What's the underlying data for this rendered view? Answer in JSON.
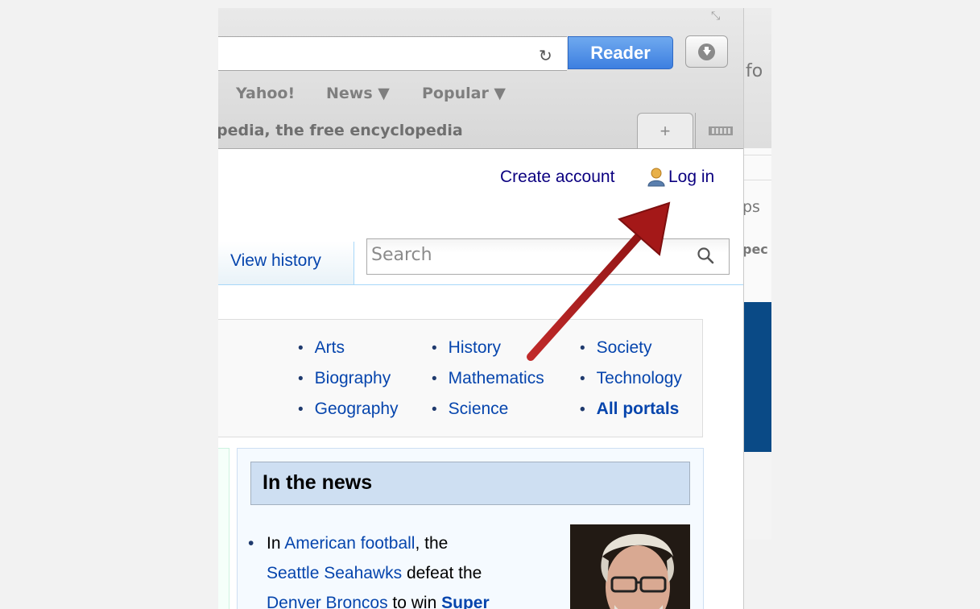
{
  "browser": {
    "reader_label": "Reader",
    "bookmarks": [
      "Yahoo!",
      "News ▼",
      "Popular ▼"
    ],
    "tab_title": "pedia, the free encyclopedia",
    "new_tab_symbol": "+",
    "reload_symbol": "↻",
    "resize_symbol": "⤡"
  },
  "wiki": {
    "create_account": "Create account",
    "login": "Log in",
    "view_history": "View history",
    "search_placeholder": "Search",
    "portals": {
      "col1": [
        "Arts",
        "Biography",
        "Geography"
      ],
      "col2": [
        "History",
        "Mathematics",
        "Science"
      ],
      "col3": [
        "Society",
        "Technology",
        "All portals"
      ]
    },
    "news": {
      "title": "In the news",
      "text_parts": {
        "p1": "In ",
        "l1": "American football",
        "p2": ", the ",
        "l2": "Seattle Seahawks",
        "p3": " defeat the ",
        "l3": "Denver Broncos",
        "p4": " to win ",
        "l4": "Super"
      }
    }
  },
  "background_window": {
    "fragments": [
      "fo",
      "ps",
      "pec"
    ]
  },
  "annotation": {
    "arrow_color": "#b31d1d"
  },
  "colors": {
    "reader_blue": "#3d7fe0",
    "wiki_link": "#0645ad",
    "news_header": "#cedff2"
  }
}
